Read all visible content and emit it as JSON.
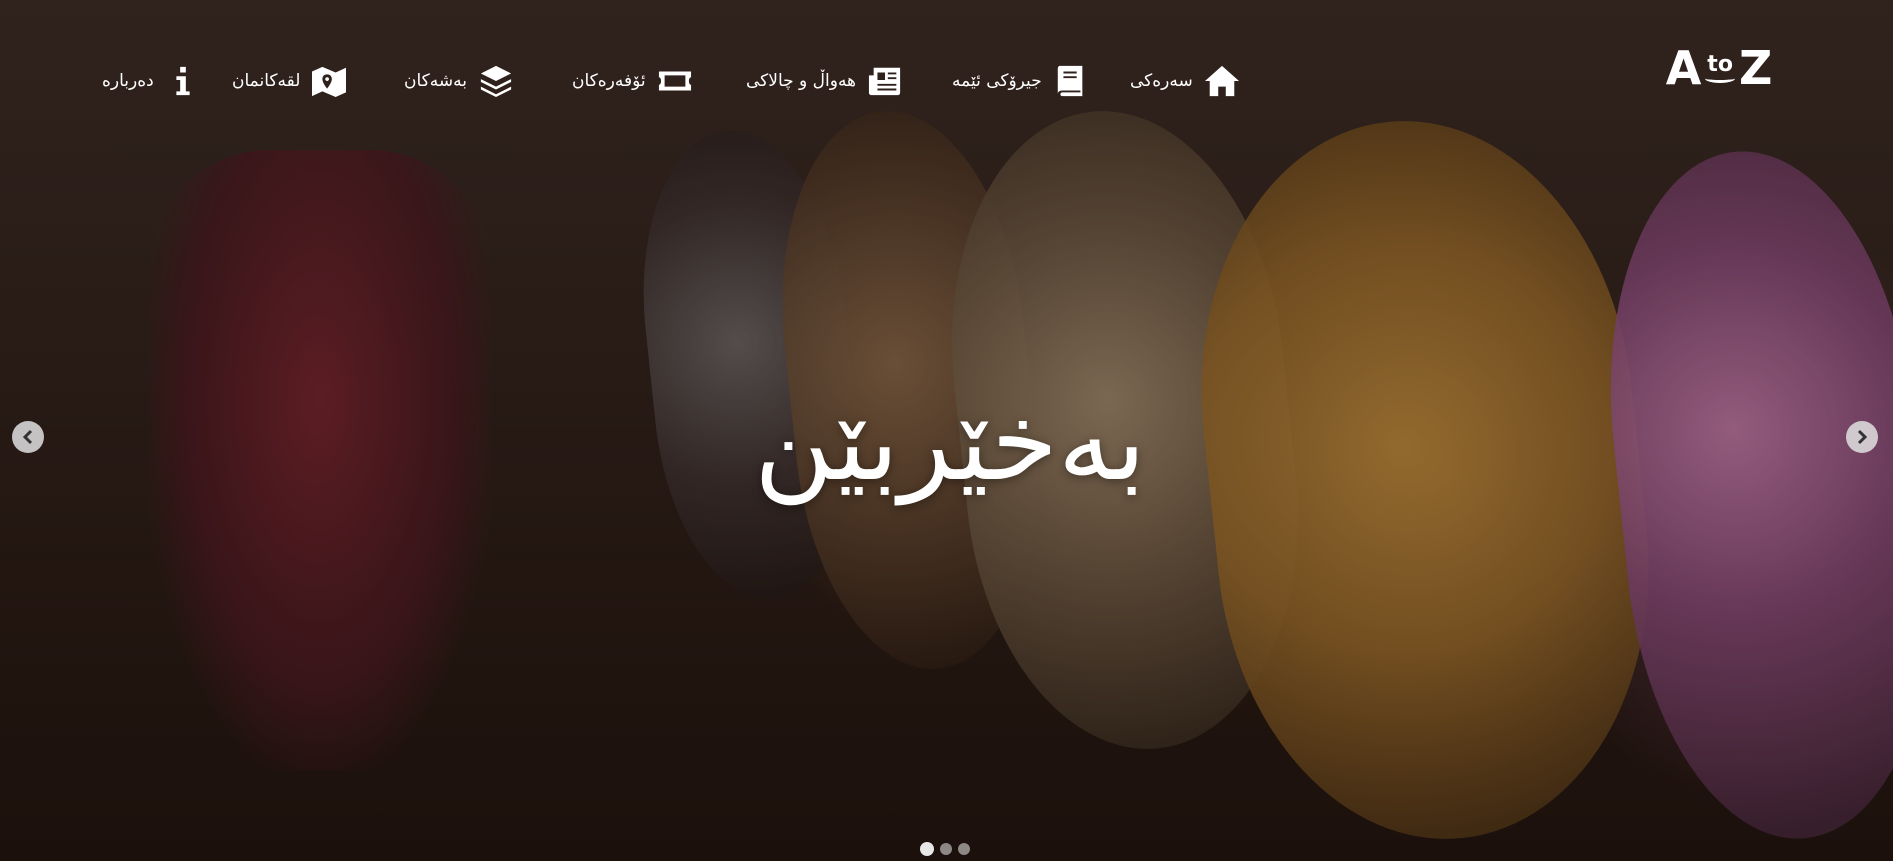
{
  "brand": {
    "logo_left": "A",
    "logo_mid": "to",
    "logo_right": "Z"
  },
  "nav": {
    "items": [
      {
        "label": "سەرەکی",
        "icon": "home-icon"
      },
      {
        "label": "جیرۆکی ئێمە",
        "icon": "book-icon"
      },
      {
        "label": "هەواڵ و چالاکی",
        "icon": "newspaper-icon"
      },
      {
        "label": "ئۆفەرەکان",
        "icon": "ticket-icon"
      },
      {
        "label": "بەشەکان",
        "icon": "layers-icon"
      },
      {
        "label": "لقەکانمان",
        "icon": "map-icon"
      },
      {
        "label": "دەربارە",
        "icon": "info-icon"
      }
    ]
  },
  "hero": {
    "title": "بەخێربێن",
    "slide_count": 3,
    "active_slide": 1
  },
  "colors": {
    "text": "#ffffff",
    "overlay": "#1e120d"
  }
}
